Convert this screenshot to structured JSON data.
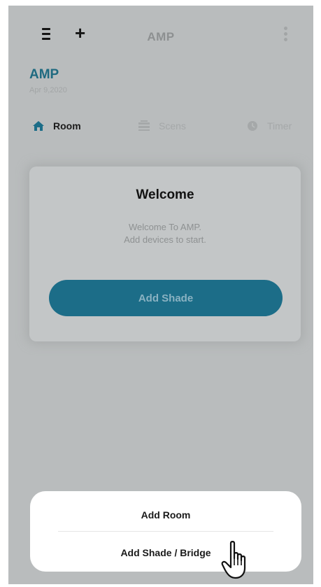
{
  "header": {
    "title": "AMP",
    "menu_icon": "hamburger-menu-icon",
    "add_icon": "plus-icon",
    "more_icon": "vertical-ellipsis-icon"
  },
  "home": {
    "name": "AMP",
    "date": "Apr 9,2020"
  },
  "tabs": [
    {
      "label": "Room",
      "icon": "home-icon",
      "active": true
    },
    {
      "label": "Scens",
      "icon": "scenes-icon",
      "active": false
    },
    {
      "label": "Timer",
      "icon": "timer-icon",
      "active": false
    }
  ],
  "welcome": {
    "title": "Welcome",
    "line1": "Welcome To AMP.",
    "line2": "Add devices to start.",
    "button_label": "Add Shade"
  },
  "sheet": {
    "add_room_label": "Add Room",
    "add_shade_bridge_label": "Add Shade / Bridge"
  },
  "colors": {
    "accent": "#1c6d88",
    "overlay": "#b9bcbd",
    "sheet": "#ffffff"
  }
}
